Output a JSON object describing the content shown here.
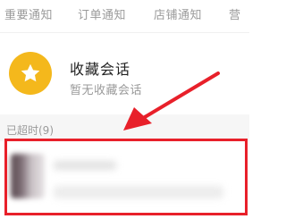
{
  "tabs": [
    {
      "label": "重要通知"
    },
    {
      "label": "订单通知"
    },
    {
      "label": "店铺通知"
    },
    {
      "label": "营"
    }
  ],
  "favorites": {
    "title": "收藏会话",
    "subtitle": "暂无收藏会话",
    "icon": "star-icon",
    "icon_color": "#f4b81c"
  },
  "section": {
    "title": "已超时(9)"
  },
  "annotation": {
    "color": "#e8202a"
  }
}
